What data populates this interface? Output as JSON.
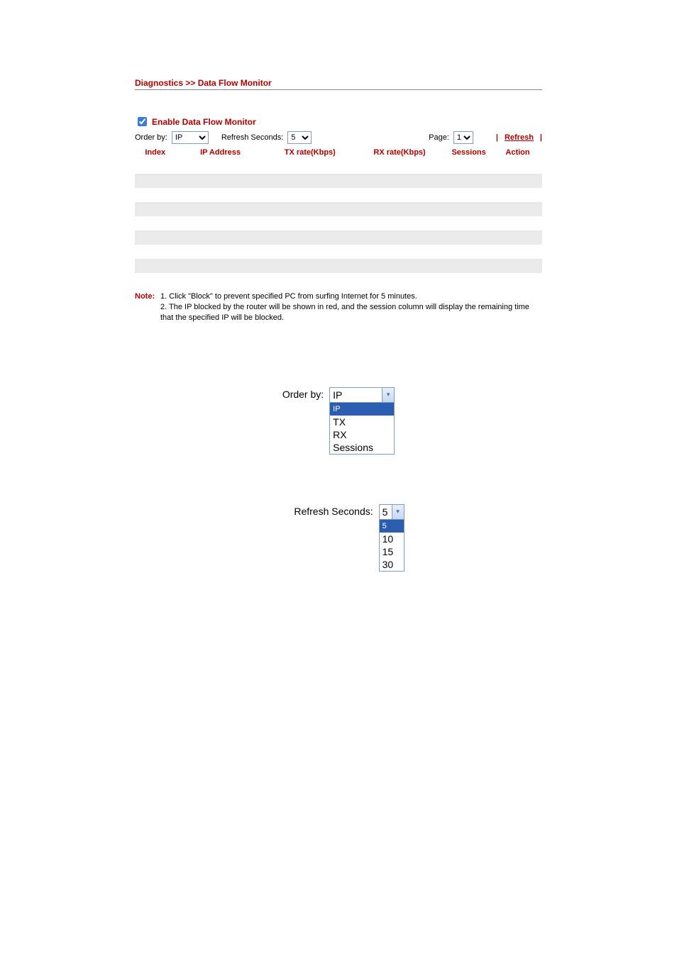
{
  "breadcrumb": "Diagnostics >> Data Flow Monitor",
  "enable": {
    "checked": true,
    "label": "Enable Data Flow Monitor"
  },
  "controls": {
    "order_by_label": "Order by:",
    "order_by_value": "IP",
    "refresh_label": "Refresh Seconds:",
    "refresh_value": "5",
    "page_label": "Page:",
    "page_value": "1",
    "refresh_link": "Refresh"
  },
  "table": {
    "headers": [
      "Index",
      "IP Address",
      "TX rate(Kbps)",
      "RX rate(Kbps)",
      "Sessions",
      "Action"
    ],
    "col_widths": [
      "10%",
      "22%",
      "22%",
      "22%",
      "12%",
      "12%"
    ],
    "row_count": 9
  },
  "note": {
    "label": "Note:",
    "lines": [
      "1. Click \"Block\" to prevent specified PC from surfing Internet for 5 minutes.",
      "2. The IP blocked by the router will be shown in red, and the session column will display the remaining time that the specified IP will be blocked."
    ]
  },
  "demo_orderby": {
    "label": "Order by:",
    "value": "IP",
    "options": [
      "IP",
      "TX",
      "RX",
      "Sessions"
    ],
    "highlighted": "IP"
  },
  "demo_refresh": {
    "label": "Refresh Seconds:",
    "value": "5",
    "options": [
      "5",
      "10",
      "15",
      "30"
    ],
    "highlighted": "5"
  }
}
